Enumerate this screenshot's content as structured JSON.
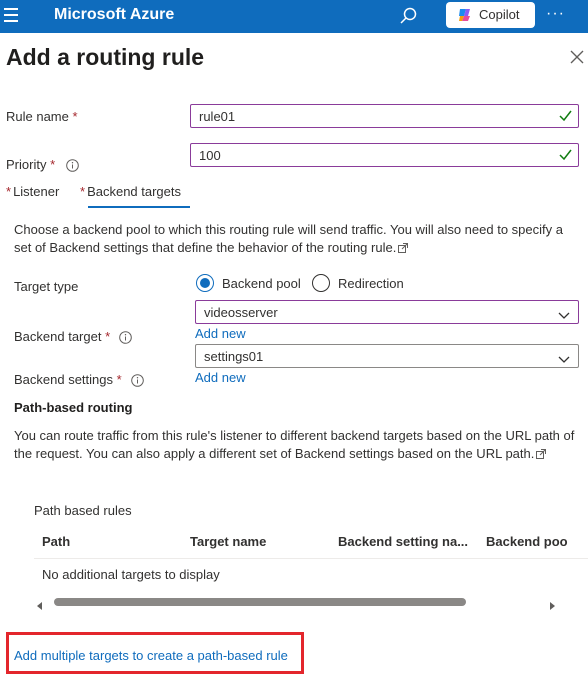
{
  "topbar": {
    "brand": "Microsoft Azure",
    "copilot_label": "Copilot",
    "more_label": "···",
    "color": "#0f6cbd"
  },
  "panel": {
    "title": "Add a routing rule"
  },
  "form": {
    "rule_name_label": "Rule name",
    "rule_name_value": "rule01",
    "priority_label": "Priority",
    "priority_value": "100",
    "required_mark": "*"
  },
  "tabs": [
    {
      "label": "Listener",
      "required": "*"
    },
    {
      "label": "Backend targets",
      "required": "*",
      "selected": true
    }
  ],
  "backend": {
    "description": "Choose a backend pool to which this routing rule will send traffic. You will also need to specify a set of Backend settings that define the behavior of the routing rule.",
    "target_type_label": "Target type",
    "radio_backend_pool": "Backend pool",
    "radio_redirection": "Redirection",
    "backend_target_label": "Backend target",
    "backend_target_value": "videosserver",
    "add_new_label": "Add new",
    "backend_settings_label": "Backend settings",
    "backend_settings_value": "settings01",
    "add_new_label_2": "Add new"
  },
  "path_routing": {
    "heading": "Path-based routing",
    "description": "You can route traffic from this rule's listener to different backend targets based on the URL path of the request. You can also apply a different set of Backend settings based on the URL path.",
    "table_caption": "Path based rules",
    "columns": [
      "Path",
      "Target name",
      "Backend setting na...",
      "Backend poo"
    ],
    "empty_text": "No additional targets to display",
    "add_multiple_link": "Add multiple targets to create a path-based rule"
  },
  "colors": {
    "accent": "#0f6cbd",
    "valid_border": "#8a3b9a",
    "valid_check": "#107c10",
    "required": "#a4262c",
    "highlight": "#e3262c"
  }
}
